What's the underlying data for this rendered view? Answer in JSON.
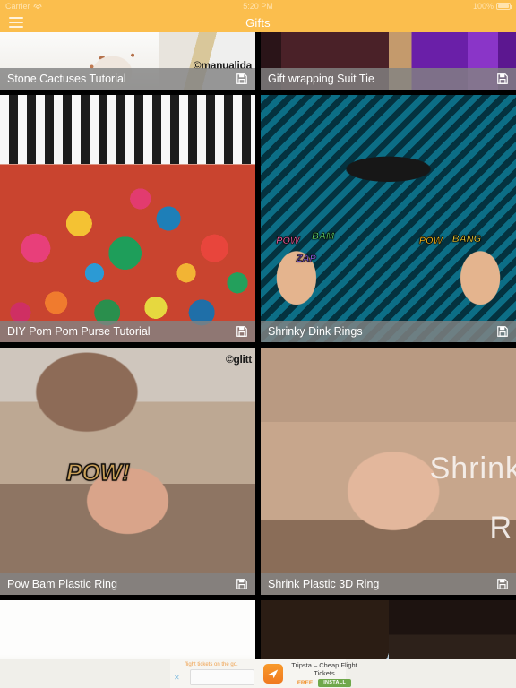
{
  "status_bar": {
    "carrier": "Carrier",
    "wifi_icon": "wifi-icon",
    "time": "5:20 PM",
    "battery_percent": "100%",
    "battery_icon": "battery-icon"
  },
  "nav": {
    "menu_icon": "hamburger-menu-icon",
    "title": "Gifts",
    "background_color": "#FBBE4D"
  },
  "theme": {
    "accent": "#FBBE4D",
    "caption_bg": "rgba(130,130,130,0.82)",
    "page_bg": "#000000"
  },
  "save_icon": "floppy-disk-save-icon",
  "grid": {
    "rows": [
      {
        "name": "row-top-partial",
        "cards": [
          {
            "title": "Stone Cactuses Tutorial",
            "watermark": "©manualida",
            "photo": "stone-cactuses-photo"
          },
          {
            "title": "Gift wrapping Suit Tie",
            "watermark": "",
            "photo": "gift-wrapping-suit-tie-photo"
          }
        ]
      },
      {
        "name": "row-middle",
        "cards": [
          {
            "title": "DIY Pom Pom Purse Tutorial",
            "watermark": "",
            "photo": "pom-pom-purse-photo"
          },
          {
            "title": "Shrinky Dink Rings",
            "watermark": "",
            "photo": "shrinky-dink-rings-photo",
            "overlays": [
              "POW",
              "BAM",
              "ZAP",
              "BANG"
            ]
          }
        ]
      },
      {
        "name": "row-bottom",
        "cards": [
          {
            "title": "Pow Bam Plastic Ring",
            "watermark": "©glitt",
            "photo": "pow-bam-plastic-ring-photo",
            "overlays": [
              "POW!"
            ]
          },
          {
            "title": "Shrink Plastic 3D Ring",
            "watermark": "",
            "photo": "shrink-plastic-3d-ring-photo",
            "overlays": [
              "Shrink",
              "R"
            ]
          }
        ]
      },
      {
        "name": "row-partial-bottom",
        "cards": [
          {
            "title": "",
            "watermark": "",
            "photo": "white-scene-photo"
          },
          {
            "title": "",
            "watermark": "",
            "photo": "fur-photo"
          },
          {
            "title": "",
            "watermark": "",
            "photo": "pins-photo"
          }
        ]
      }
    ]
  },
  "ad": {
    "tagline": "flight tickets on the go.",
    "app_icon": "tripsta-app-icon",
    "title": "Tripsta – Cheap Flight Tickets",
    "price_label": "FREE",
    "cta_label": "INSTALL",
    "close_icon": "ad-close-icon"
  }
}
